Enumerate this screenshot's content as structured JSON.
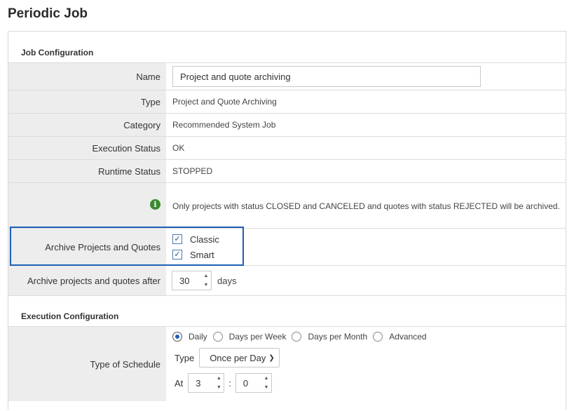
{
  "page_title": "Periodic Job",
  "job_config": {
    "header": "Job Configuration",
    "name_label": "Name",
    "name_value": "Project and quote archiving",
    "type_label": "Type",
    "type_value": "Project and Quote Archiving",
    "category_label": "Category",
    "category_value": "Recommended System Job",
    "execution_status_label": "Execution Status",
    "execution_status_value": "OK",
    "runtime_status_label": "Runtime Status",
    "runtime_status_value": "STOPPED",
    "info_text": "Only projects with status CLOSED and CANCELED and quotes with status REJECTED will be archived.",
    "archive_label": "Archive Projects and Quotes",
    "archive_options": [
      {
        "label": "Classic",
        "checked": true
      },
      {
        "label": "Smart",
        "checked": true
      }
    ],
    "archive_after_label": "Archive projects and quotes after",
    "archive_after_value": "30",
    "archive_after_unit": "days"
  },
  "execution_config": {
    "header": "Execution Configuration",
    "schedule_label": "Type of Schedule",
    "schedule_options": [
      {
        "label": "Daily",
        "selected": true
      },
      {
        "label": "Days per Week",
        "selected": false
      },
      {
        "label": "Days per Month",
        "selected": false
      },
      {
        "label": "Advanced",
        "selected": false
      }
    ],
    "type_label": "Type",
    "type_value": "Once per Day",
    "at_label": "At",
    "at_hour": "3",
    "time_separator": ":",
    "at_minute": "0"
  },
  "colors": {
    "highlight_border": "#1f5fb5",
    "label_background": "#ededed",
    "info_icon": "#3b8a2e"
  }
}
